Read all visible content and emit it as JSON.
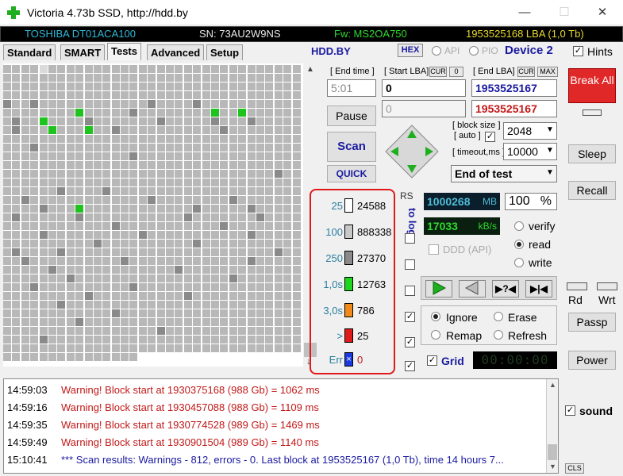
{
  "window": {
    "title": "Victoria 4.73b SSD, http://hdd.by",
    "icon": "green-cross-icon"
  },
  "info_bar": {
    "model": "TOSHIBA DT01ACA100",
    "serial": "SN: 73AU2W9NS",
    "firmware": "Fw: MS2OA750",
    "capacity": "1953525168 LBA (1,0 Tb)"
  },
  "tabs": [
    "Standard",
    "SMART",
    "Tests",
    "Advanced",
    "Setup"
  ],
  "active_tab": "Tests",
  "header": {
    "hddby": "HDD.BY",
    "hex": "HEX",
    "api": "API",
    "pio": "PIO",
    "device": "Device 2",
    "hints": "Hints"
  },
  "controls": {
    "end_time_label": "[ End time ]",
    "end_time_value": "5:01",
    "start_lba_label": "[ Start LBA]",
    "cur_label": "CUR",
    "cur_value": "0",
    "start_lba_value": "0",
    "start_lba_second": "0",
    "end_lba_label": "[ End LBA]",
    "end_cur_label": "CUR",
    "max_label": "MAX",
    "end_lba_value": "1953525167",
    "end_lba_second": "1953525167",
    "pause": "Pause",
    "scan": "Scan",
    "quick": "QUICK",
    "block_size_label": "[ block size ]",
    "auto_label": "[ auto ]",
    "block_size": "2048",
    "timeout_label": "[ timeout,ms ]",
    "timeout": "10000",
    "end_action": "End of test"
  },
  "legend": {
    "rs": "RS",
    "to_log": "to log:",
    "rows": [
      {
        "label": "25",
        "value": "24588",
        "color": "#ffffff",
        "logged": false
      },
      {
        "label": "100",
        "value": "888338",
        "color": "#c8c8c8",
        "logged": false
      },
      {
        "label": "250",
        "value": "27370",
        "color": "#8a8a8a",
        "logged": false
      },
      {
        "label": "1,0s",
        "value": "12763",
        "color": "#1ed61e",
        "logged": false
      },
      {
        "label": "3,0s",
        "value": "786",
        "color": "#f08a1a",
        "logged": true
      },
      {
        "label": ">",
        "value": "25",
        "color": "#e01a1a",
        "logged": true
      },
      {
        "label": "Err",
        "value": "0",
        "color": "#1a3ae0",
        "logged": true
      }
    ]
  },
  "status": {
    "mb": "1000268",
    "mb_unit": "MB",
    "percent": "100",
    "percent_unit": "%",
    "speed": "17033",
    "speed_unit": "kB/s",
    "ddd": "DDD (API)",
    "verify": "verify",
    "read": "read",
    "write": "write",
    "ignore": "Ignore",
    "erase": "Erase",
    "remap": "Remap",
    "refresh": "Refresh",
    "grid": "Grid",
    "timer": "00:00:00"
  },
  "side": {
    "break": "Break All",
    "sleep": "Sleep",
    "recall": "Recall",
    "rd": "Rd",
    "wrt": "Wrt",
    "passp": "Passp",
    "power": "Power",
    "sound": "sound",
    "cls": "CLS"
  },
  "log": [
    {
      "time": "14:59:03",
      "msg": "Warning! Block start at 1930375168 (988 Gb)  = 1062 ms",
      "type": "warn"
    },
    {
      "time": "14:59:16",
      "msg": "Warning! Block start at 1930457088 (988 Gb)  = 1109 ms",
      "type": "warn"
    },
    {
      "time": "14:59:35",
      "msg": "Warning! Block start at 1930774528 (989 Gb)  = 1469 ms",
      "type": "warn"
    },
    {
      "time": "14:59:49",
      "msg": "Warning! Block start at 1930901504 (989 Gb)  = 1140 ms",
      "type": "warn"
    },
    {
      "time": "15:10:41",
      "msg": "*** Scan results: Warnings - 812, errors - 0. Last block at 1953525167 (1,0 Tb), time 14 hours 7...",
      "type": "info"
    }
  ]
}
